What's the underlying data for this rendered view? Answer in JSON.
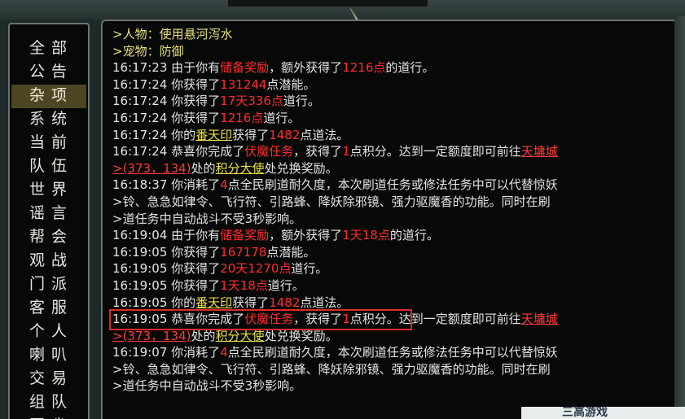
{
  "sidebar": {
    "items": [
      {
        "label": "全部",
        "active": false
      },
      {
        "label": "公告",
        "active": false
      },
      {
        "label": "杂项",
        "active": true
      },
      {
        "label": "系统",
        "active": false
      },
      {
        "label": "当前",
        "active": false
      },
      {
        "label": "队伍",
        "active": false
      },
      {
        "label": "世界",
        "active": false
      },
      {
        "label": "谣言",
        "active": false
      },
      {
        "label": "帮会",
        "active": false
      },
      {
        "label": "观战",
        "active": false
      },
      {
        "label": "门派",
        "active": false
      },
      {
        "label": "客服",
        "active": false
      },
      {
        "label": "个人",
        "active": false
      },
      {
        "label": "喇叭",
        "active": false
      },
      {
        "label": "交易",
        "active": false
      },
      {
        "label": "组队",
        "active": false
      },
      {
        "label": "同省",
        "active": false
      }
    ]
  },
  "chat": {
    "lines": [
      [
        {
          "t": ">人物：使用悬河泻水",
          "c": "y"
        }
      ],
      [
        {
          "t": ">宠物：防御",
          "c": "y"
        }
      ],
      [
        {
          "t": "16:17:23 ",
          "c": "ts"
        },
        {
          "t": "由于你有",
          "c": "w"
        },
        {
          "t": "储备奖励",
          "c": "r"
        },
        {
          "t": "，额外获得了",
          "c": "w"
        },
        {
          "t": "1216点",
          "c": "r"
        },
        {
          "t": "的道行。",
          "c": "w"
        }
      ],
      [
        {
          "t": "16:17:24 ",
          "c": "ts"
        },
        {
          "t": "你获得了",
          "c": "w"
        },
        {
          "t": "131244",
          "c": "r"
        },
        {
          "t": "点潜能。",
          "c": "w"
        }
      ],
      [
        {
          "t": "16:17:24 ",
          "c": "ts"
        },
        {
          "t": "你获得了",
          "c": "w"
        },
        {
          "t": "17天336点",
          "c": "r"
        },
        {
          "t": "道行。",
          "c": "w"
        }
      ],
      [
        {
          "t": "16:17:24 ",
          "c": "ts"
        },
        {
          "t": "你获得了",
          "c": "w"
        },
        {
          "t": "1216点",
          "c": "r"
        },
        {
          "t": "道行。",
          "c": "w"
        }
      ],
      [
        {
          "t": "16:17:24 ",
          "c": "ts"
        },
        {
          "t": "你的",
          "c": "w"
        },
        {
          "t": "番天印",
          "c": "yl"
        },
        {
          "t": "获得了",
          "c": "w"
        },
        {
          "t": "1482",
          "c": "r"
        },
        {
          "t": "点道法。",
          "c": "w"
        }
      ],
      [
        {
          "t": "16:17:24 ",
          "c": "ts"
        },
        {
          "t": "恭喜你完成了",
          "c": "w"
        },
        {
          "t": "伏魔任务",
          "c": "r"
        },
        {
          "t": "，获得了",
          "c": "w"
        },
        {
          "t": "1",
          "c": "r"
        },
        {
          "t": "点积分。达到一定额度即可前往",
          "c": "w"
        },
        {
          "t": "天墉城",
          "c": "rl"
        }
      ],
      [
        {
          "t": ">(373，134)",
          "c": "rl"
        },
        {
          "t": "处的",
          "c": "w"
        },
        {
          "t": "积分大使",
          "c": "yl"
        },
        {
          "t": "处兑换奖励。",
          "c": "w"
        }
      ],
      [
        {
          "t": "16:18:37 ",
          "c": "ts"
        },
        {
          "t": "你消耗了",
          "c": "w"
        },
        {
          "t": "4",
          "c": "r"
        },
        {
          "t": "点全民刷道耐久度，本次刷道任务或修法任务中可以代替惊妖",
          "c": "w"
        }
      ],
      [
        {
          "t": ">铃、急急如律令、飞行符、引路蜂、降妖除邪镜、强力驱魔香的功能。同时在刷",
          "c": "w"
        }
      ],
      [
        {
          "t": ">道任务中自动战斗不受3秒影响。",
          "c": "w"
        }
      ],
      [
        {
          "t": "16:19:04 ",
          "c": "ts"
        },
        {
          "t": "由于你有",
          "c": "w"
        },
        {
          "t": "储备奖励",
          "c": "r"
        },
        {
          "t": "，额外获得了",
          "c": "w"
        },
        {
          "t": "1天18点",
          "c": "r"
        },
        {
          "t": "的道行。",
          "c": "w"
        }
      ],
      [
        {
          "t": "16:19:05 ",
          "c": "ts"
        },
        {
          "t": "你获得了",
          "c": "w"
        },
        {
          "t": "167178",
          "c": "r"
        },
        {
          "t": "点潜能。",
          "c": "w"
        }
      ],
      [
        {
          "t": "16:19:05 ",
          "c": "ts"
        },
        {
          "t": "你获得了",
          "c": "w"
        },
        {
          "t": "20天1270点",
          "c": "r"
        },
        {
          "t": "道行。",
          "c": "w"
        }
      ],
      [
        {
          "t": "16:19:05 ",
          "c": "ts"
        },
        {
          "t": "你获得了",
          "c": "w"
        },
        {
          "t": "1天18点",
          "c": "r"
        },
        {
          "t": "道行。",
          "c": "w"
        }
      ],
      [
        {
          "t": "16:19:05 ",
          "c": "ts"
        },
        {
          "t": "你的",
          "c": "w"
        },
        {
          "t": "番天印",
          "c": "yl"
        },
        {
          "t": "获得了",
          "c": "w"
        },
        {
          "t": "1482",
          "c": "r"
        },
        {
          "t": "点道法。",
          "c": "w"
        }
      ],
      [
        {
          "t": "16:19:05 ",
          "c": "ts"
        },
        {
          "t": "恭喜你完成了",
          "c": "w"
        },
        {
          "t": "伏魔任务",
          "c": "r"
        },
        {
          "t": "，获得了",
          "c": "w"
        },
        {
          "t": "1",
          "c": "r"
        },
        {
          "t": "点积分。达到一定额度即可前往",
          "c": "w"
        },
        {
          "t": "天墉城",
          "c": "rl"
        }
      ],
      [
        {
          "t": ">(373，134)",
          "c": "rl"
        },
        {
          "t": "处的",
          "c": "w"
        },
        {
          "t": "积分大使",
          "c": "yl"
        },
        {
          "t": "处兑换奖励。",
          "c": "w"
        }
      ],
      [
        {
          "t": "16:19:07 ",
          "c": "ts"
        },
        {
          "t": "你消耗了",
          "c": "w"
        },
        {
          "t": "4",
          "c": "r"
        },
        {
          "t": "点全民刷道耐久度，本次刷道任务或修法任务中可以代替惊妖",
          "c": "w"
        }
      ],
      [
        {
          "t": ">铃、急急如律令、飞行符、引路蜂、降妖除邪镜、强力驱魔香的功能。同时在刷",
          "c": "w"
        }
      ],
      [
        {
          "t": ">道任务中自动战斗不受3秒影响。",
          "c": "w"
        }
      ]
    ]
  },
  "colors": {
    "accent_red": "#ff2b2b",
    "accent_yellow": "#e8e04a",
    "panel_bg": "#070808",
    "active_tab": "#4d4622"
  },
  "watermark": {
    "text": "三高游戏"
  }
}
